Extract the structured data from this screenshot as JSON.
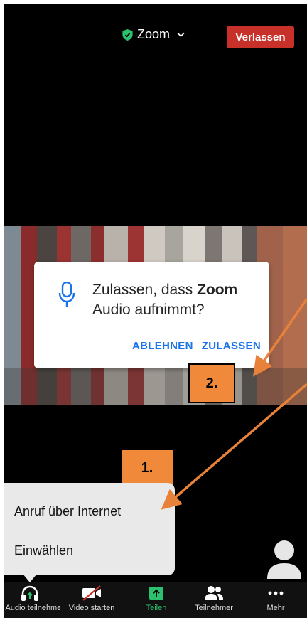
{
  "header": {
    "meeting_title": "Zoom",
    "leave_label": "Verlassen"
  },
  "dialog": {
    "message_prefix": "Zulassen, dass ",
    "message_app": "Zoom",
    "message_suffix": "Audio aufnimmt?",
    "deny_label": "ABLEHNEN",
    "allow_label": "ZULASSEN"
  },
  "annotations": {
    "step1": "1.",
    "step2": "2."
  },
  "audio_menu": {
    "items": [
      {
        "label": "Anruf über Internet"
      },
      {
        "label": "Einwählen"
      }
    ]
  },
  "toolbar": {
    "items": [
      {
        "label": "An Audio teilnehmen",
        "icon": "headphones-icon"
      },
      {
        "label": "Video starten",
        "icon": "video-off-icon"
      },
      {
        "label": "Teilen",
        "icon": "share-icon"
      },
      {
        "label": "Teilnehmer",
        "icon": "participants-icon"
      },
      {
        "label": "Mehr",
        "icon": "more-icon"
      }
    ]
  },
  "colors": {
    "leave_button": "#c8302a",
    "share_accent": "#2cc16e",
    "dialog_action": "#1a73e8",
    "annotation_badge": "#f08a3a",
    "annotation_arrow": "#e8823a"
  }
}
